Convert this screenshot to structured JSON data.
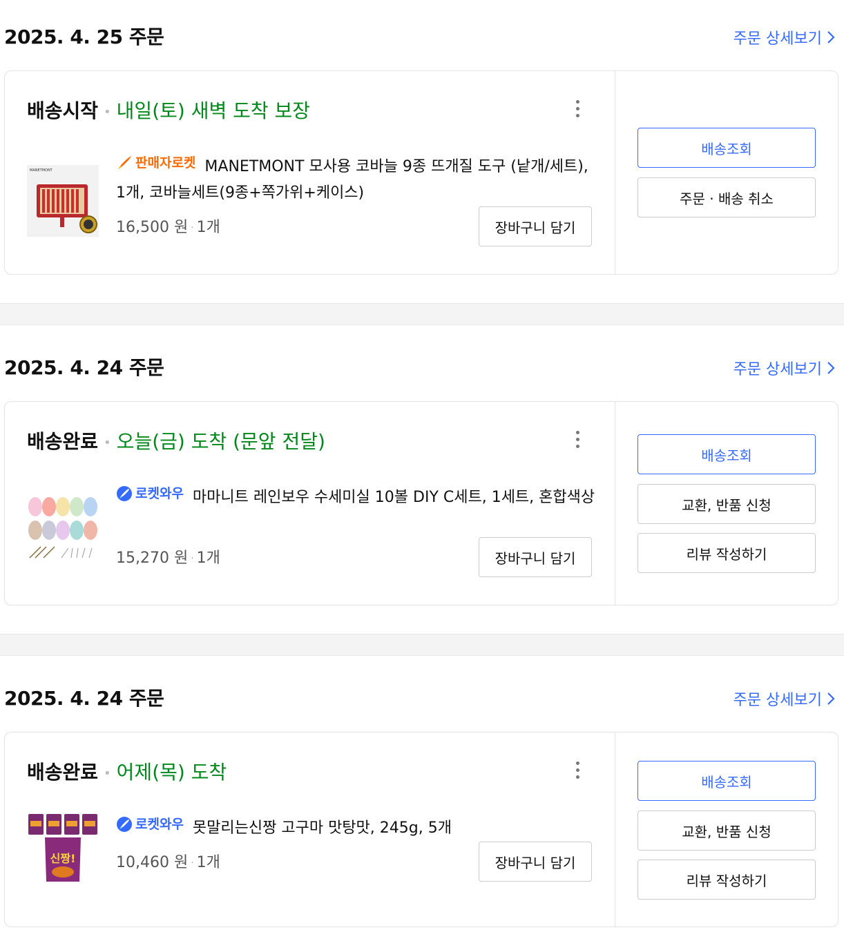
{
  "orders": [
    {
      "date": "2025. 4. 25 주문",
      "detail_link": "주문 상세보기",
      "status": "배송시작",
      "status_sep": "•",
      "eta": "내일(토) 새벽 도착 보장",
      "badge": "판매자로켓",
      "badge_type": "seller",
      "product_name": "MANETMONT 모사용 코바늘 9종 뜨개질 도구 (낱개/세트), 1개, 코바늘세트(9종+쪽가위+케이스)",
      "thumb_brand_text": "MANETMONT",
      "price": "16,500 원",
      "qty": "1개",
      "cart_button": "장바구니 담기",
      "actions": [
        "배송조회",
        "주문 · 배송 취소"
      ]
    },
    {
      "date": "2025. 4. 24 주문",
      "detail_link": "주문 상세보기",
      "status": "배송완료",
      "status_sep": "•",
      "eta": "오늘(금) 도착 (문앞 전달)",
      "badge": "로켓와우",
      "badge_type": "wow",
      "product_name": "마마니트 레인보우 수세미실 10볼 DIY C세트, 1세트, 혼합색상",
      "price": "15,270 원",
      "qty": "1개",
      "cart_button": "장바구니 담기",
      "actions": [
        "배송조회",
        "교환, 반품 신청",
        "리뷰 작성하기"
      ]
    },
    {
      "date": "2025. 4. 24 주문",
      "detail_link": "주문 상세보기",
      "status": "배송완료",
      "status_sep": "•",
      "eta": "어제(목) 도착",
      "badge": "로켓와우",
      "badge_type": "wow",
      "product_name": "못말리는신짱 고구마 맛탕맛, 245g, 5개",
      "thumb_product_text": "신짱!",
      "price": "10,460 원",
      "qty": "1개",
      "cart_button": "장바구니 담기",
      "actions": [
        "배송조회",
        "교환, 반품 신청",
        "리뷰 작성하기"
      ]
    }
  ],
  "colors": {
    "accent_blue": "#346aff",
    "eta_green": "#00891a",
    "seller_orange": "#ff6a00"
  }
}
